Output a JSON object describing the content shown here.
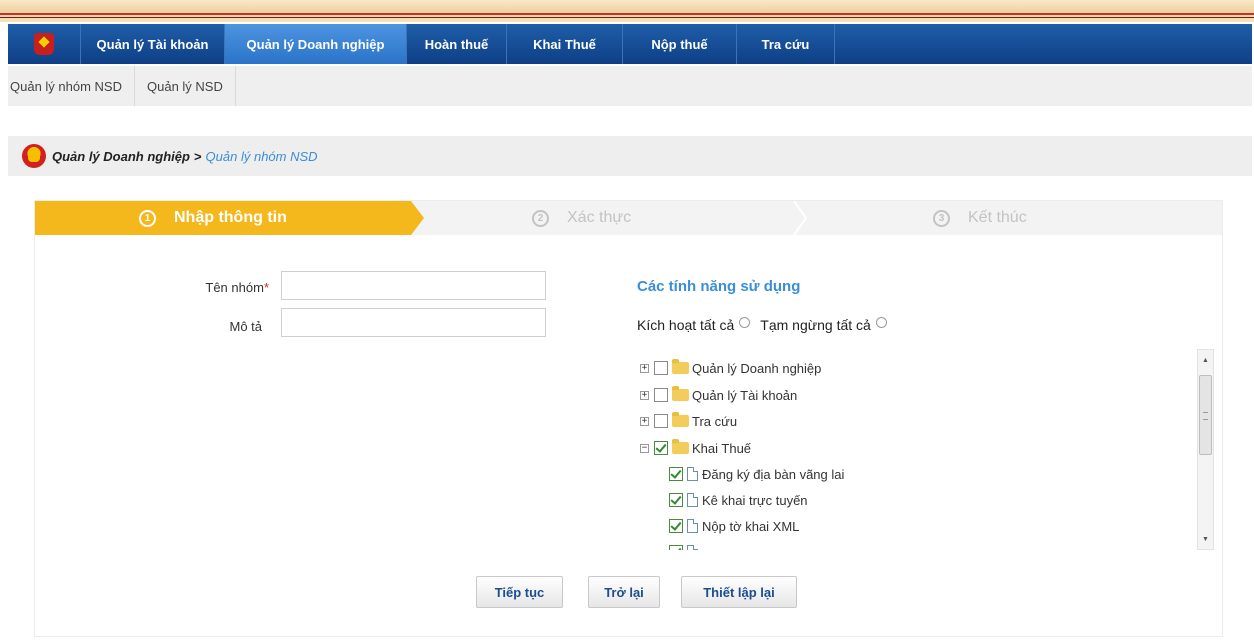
{
  "nav": {
    "items": [
      {
        "label": "Quản lý Tài khoản",
        "active": false
      },
      {
        "label": "Quản lý Doanh nghiệp",
        "active": true
      },
      {
        "label": "Hoàn thuế",
        "active": false
      },
      {
        "label": "Khai Thuế",
        "active": false
      },
      {
        "label": "Nộp thuế",
        "active": false
      },
      {
        "label": "Tra cứu",
        "active": false
      }
    ]
  },
  "subnav": {
    "items": [
      "Quản lý nhóm NSD",
      "Quản lý NSD"
    ]
  },
  "breadcrumb": {
    "current": "Quản lý Doanh nghiệp",
    "separator": ">",
    "link": "Quản lý nhóm NSD"
  },
  "steps": [
    {
      "num": "1",
      "label": "Nhập thông tin",
      "active": true
    },
    {
      "num": "2",
      "label": "Xác thực",
      "active": false
    },
    {
      "num": "3",
      "label": "Kết thúc",
      "active": false
    }
  ],
  "form": {
    "group_name_label": "Tên nhóm",
    "required_mark": "*",
    "group_name_value": "",
    "description_label": "Mô tả",
    "description_value": ""
  },
  "features": {
    "title": "Các tính năng sử dụng",
    "activate_all": "Kích hoạt tất cả",
    "suspend_all": "Tạm ngừng tất cả",
    "tree": [
      {
        "label": "Quản lý Doanh nghiệp",
        "checked": false,
        "expander": "+",
        "kind": "folder"
      },
      {
        "label": "Quản lý Tài khoản",
        "checked": false,
        "expander": "+",
        "kind": "folder"
      },
      {
        "label": "Tra cứu",
        "checked": false,
        "expander": "+",
        "kind": "folder"
      },
      {
        "label": "Khai Thuế",
        "checked": true,
        "expander": "−",
        "kind": "folder"
      },
      {
        "label": "Đăng ký địa bàn vãng lai",
        "checked": true,
        "kind": "doc"
      },
      {
        "label": "Kê khai trực tuyến",
        "checked": true,
        "kind": "doc"
      },
      {
        "label": "Nộp tờ khai XML",
        "checked": true,
        "kind": "doc"
      }
    ]
  },
  "buttons": {
    "continue": "Tiếp tục",
    "back": "Trở lại",
    "reset": "Thiết lập lại"
  },
  "colors": {
    "nav_bg": "#0e3f86",
    "nav_active": "#2b73c8",
    "step_active": "#f5b81c",
    "link": "#3a8ed8"
  }
}
